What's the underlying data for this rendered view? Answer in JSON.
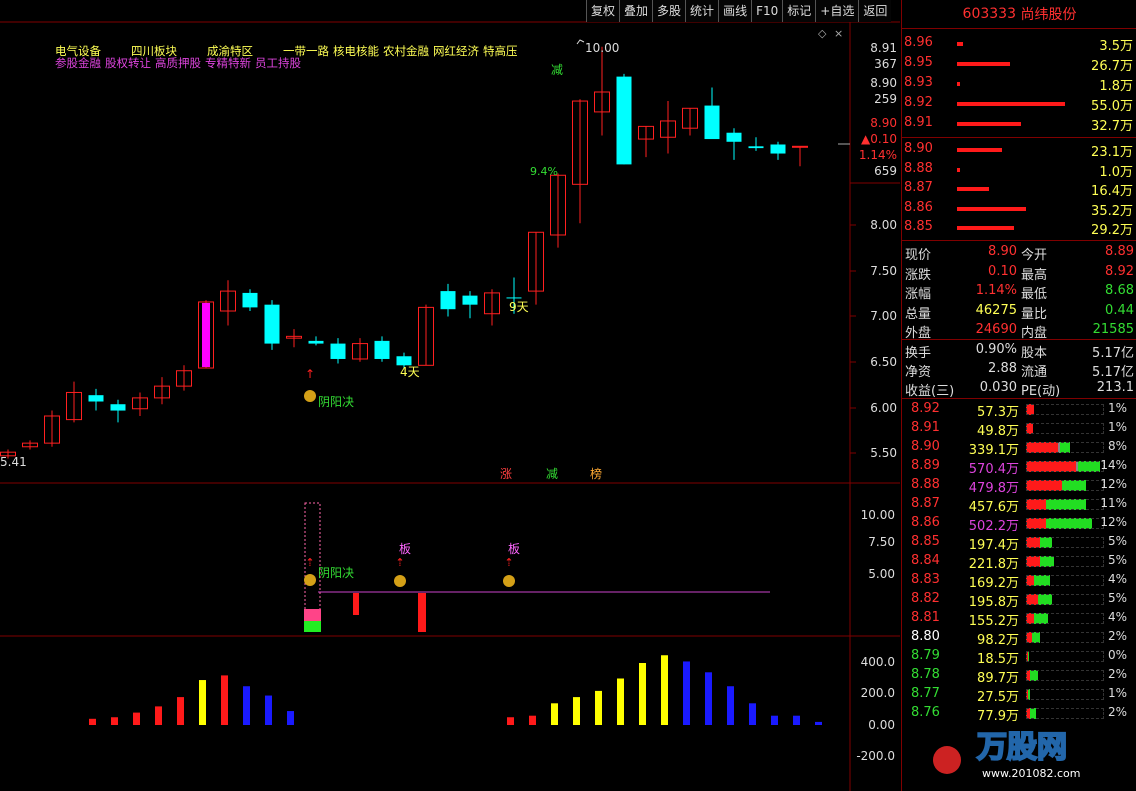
{
  "toolbar": [
    "复权",
    "叠加",
    "多股",
    "统计",
    "画线",
    "F10",
    "标记",
    "+自选",
    "返回"
  ],
  "stock": {
    "code": "603333",
    "name": "尚纬股份"
  },
  "tags": {
    "line1": [
      "电气设备",
      "四川板块",
      "成渝特区",
      "一带一路",
      "核电核能",
      "农村金融",
      "网红经济",
      "特高压"
    ],
    "line2": [
      "参股金融",
      "股权转让",
      "高质押股",
      "专精特新",
      "员工持股"
    ]
  },
  "price_axis": [
    "8.91",
    "367",
    "8.90",
    "259",
    "8.90",
    "▲0.10",
    "1.14%",
    "659",
    "8.00",
    "7.50",
    "7.00",
    "6.50",
    "6.00",
    "5.50"
  ],
  "labels": {
    "high_mark": "10.00",
    "low_mark": "5.41",
    "jian": "减",
    "pct": "9.4%",
    "days9": "9天",
    "days4": "4天",
    "yinyang": "阴阳决",
    "zhang": "涨",
    "jian2": "减",
    "bang": "榜",
    "ban": "板"
  },
  "sub1_axis": [
    "10.00",
    "7.50",
    "5.00"
  ],
  "sub2_axis": [
    "400.0",
    "200.0",
    "0.00",
    "-200.0"
  ],
  "chart_data": {
    "type": "candlestick",
    "candles": [
      {
        "o": 5.48,
        "c": 5.52,
        "h": 5.55,
        "l": 5.45
      },
      {
        "o": 5.58,
        "c": 5.62,
        "h": 5.65,
        "l": 5.55
      },
      {
        "o": 5.62,
        "c": 5.92,
        "h": 5.98,
        "l": 5.58
      },
      {
        "o": 5.88,
        "c": 6.18,
        "h": 6.3,
        "l": 5.85
      },
      {
        "o": 6.15,
        "c": 6.08,
        "h": 6.22,
        "l": 5.98
      },
      {
        "o": 6.05,
        "c": 5.98,
        "h": 6.1,
        "l": 5.85
      },
      {
        "o": 6.0,
        "c": 6.12,
        "h": 6.18,
        "l": 5.92
      },
      {
        "o": 6.12,
        "c": 6.25,
        "h": 6.35,
        "l": 6.05
      },
      {
        "o": 6.25,
        "c": 6.42,
        "h": 6.48,
        "l": 6.2
      },
      {
        "o": 6.45,
        "c": 7.18,
        "h": 7.2,
        "l": 6.45
      },
      {
        "o": 7.08,
        "c": 7.3,
        "h": 7.42,
        "l": 6.92
      },
      {
        "o": 7.28,
        "c": 7.12,
        "h": 7.32,
        "l": 7.08
      },
      {
        "o": 7.15,
        "c": 6.72,
        "h": 7.2,
        "l": 6.65
      },
      {
        "o": 6.78,
        "c": 6.8,
        "h": 6.88,
        "l": 6.68
      },
      {
        "o": 6.75,
        "c": 6.72,
        "h": 6.8,
        "l": 6.7
      },
      {
        "o": 6.72,
        "c": 6.55,
        "h": 6.78,
        "l": 6.5
      },
      {
        "o": 6.55,
        "c": 6.72,
        "h": 6.78,
        "l": 6.52
      },
      {
        "o": 6.75,
        "c": 6.55,
        "h": 6.8,
        "l": 6.52
      },
      {
        "o": 6.58,
        "c": 6.48,
        "h": 6.62,
        "l": 6.45
      },
      {
        "o": 6.48,
        "c": 7.12,
        "h": 7.15,
        "l": 6.48
      },
      {
        "o": 7.3,
        "c": 7.1,
        "h": 7.38,
        "l": 7.02
      },
      {
        "o": 7.25,
        "c": 7.15,
        "h": 7.3,
        "l": 7.0
      },
      {
        "o": 7.05,
        "c": 7.28,
        "h": 7.32,
        "l": 6.92
      },
      {
        "o": 7.23,
        "c": 7.22,
        "h": 7.45,
        "l": 7.05
      },
      {
        "o": 7.3,
        "c": 7.95,
        "h": 7.95,
        "l": 7.15
      },
      {
        "o": 7.92,
        "c": 8.58,
        "h": 8.6,
        "l": 7.78
      },
      {
        "o": 8.48,
        "c": 9.4,
        "h": 9.42,
        "l": 8.05
      },
      {
        "o": 9.28,
        "c": 9.5,
        "h": 10.0,
        "l": 9.02
      },
      {
        "o": 9.67,
        "c": 8.7,
        "h": 9.7,
        "l": 8.7
      },
      {
        "o": 8.98,
        "c": 9.12,
        "h": 9.12,
        "l": 8.78
      },
      {
        "o": 9.0,
        "c": 9.18,
        "h": 9.4,
        "l": 8.82
      },
      {
        "o": 9.1,
        "c": 9.32,
        "h": 9.32,
        "l": 9.02
      },
      {
        "o": 9.35,
        "c": 8.98,
        "h": 9.55,
        "l": 8.98
      },
      {
        "o": 9.05,
        "c": 8.95,
        "h": 9.1,
        "l": 8.75
      },
      {
        "o": 8.9,
        "c": 8.88,
        "h": 9.0,
        "l": 8.85
      },
      {
        "o": 8.92,
        "c": 8.82,
        "h": 8.95,
        "l": 8.75
      },
      {
        "o": 8.9,
        "c": 8.9,
        "h": 8.9,
        "l": 8.68
      }
    ],
    "sub2_bars": [
      {
        "v": 40,
        "c": "#ff1a1a"
      },
      {
        "v": 50,
        "c": "#ff1a1a"
      },
      {
        "v": 80,
        "c": "#ff1a1a"
      },
      {
        "v": 120,
        "c": "#ff1a1a"
      },
      {
        "v": 180,
        "c": "#ff1a1a"
      },
      {
        "v": 290,
        "c": "#ffff00"
      },
      {
        "v": 320,
        "c": "#ff1a1a"
      },
      {
        "v": 250,
        "c": "#1a1aff"
      },
      {
        "v": 190,
        "c": "#1a1aff"
      },
      {
        "v": 90,
        "c": "#1a1aff"
      },
      null,
      null,
      null,
      null,
      null,
      null,
      null,
      null,
      null,
      {
        "v": 50,
        "c": "#ff1a1a"
      },
      {
        "v": 60,
        "c": "#ff1a1a"
      },
      {
        "v": 140,
        "c": "#ffff00"
      },
      {
        "v": 180,
        "c": "#ffff00"
      },
      {
        "v": 220,
        "c": "#ffff00"
      },
      {
        "v": 300,
        "c": "#ffff00"
      },
      {
        "v": 400,
        "c": "#ffff00"
      },
      {
        "v": 450,
        "c": "#ffff00"
      },
      {
        "v": 410,
        "c": "#1a1aff"
      },
      {
        "v": 340,
        "c": "#1a1aff"
      },
      {
        "v": 250,
        "c": "#1a1aff"
      },
      {
        "v": 140,
        "c": "#1a1aff"
      },
      {
        "v": 60,
        "c": "#1a1aff"
      },
      {
        "v": 60,
        "c": "#1a1aff"
      },
      {
        "v": 20,
        "c": "#1a1aff"
      }
    ]
  },
  "orderbook": {
    "asks": [
      {
        "p": "8.96",
        "v": "3.5万",
        "w": 6
      },
      {
        "p": "8.95",
        "v": "26.7万",
        "w": 53
      },
      {
        "p": "8.93",
        "v": "1.8万",
        "w": 3
      },
      {
        "p": "8.92",
        "v": "55.0万",
        "w": 108
      },
      {
        "p": "8.91",
        "v": "32.7万",
        "w": 64
      }
    ],
    "bids": [
      {
        "p": "8.90",
        "v": "23.1万",
        "w": 45
      },
      {
        "p": "8.88",
        "v": "1.0万",
        "w": 3
      },
      {
        "p": "8.87",
        "v": "16.4万",
        "w": 32
      },
      {
        "p": "8.86",
        "v": "35.2万",
        "w": 69
      },
      {
        "p": "8.85",
        "v": "29.2万",
        "w": 57
      }
    ]
  },
  "quote": [
    {
      "l1": "现价",
      "v1": "8.90",
      "c1": "#ff3030",
      "l2": "今开",
      "v2": "8.89",
      "c2": "#ff3030"
    },
    {
      "l1": "涨跌",
      "v1": "0.10",
      "c1": "#ff3030",
      "l2": "最高",
      "v2": "8.92",
      "c2": "#ff3030"
    },
    {
      "l1": "涨幅",
      "v1": "1.14%",
      "c1": "#ff3030",
      "l2": "最低",
      "v2": "8.68",
      "c2": "#33dd33"
    },
    {
      "l1": "总量",
      "v1": "46275",
      "c1": "#ffff55",
      "l2": "量比",
      "v2": "0.44",
      "c2": "#33dd33"
    },
    {
      "l1": "外盘",
      "v1": "24690",
      "c1": "#ff3030",
      "l2": "内盘",
      "v2": "21585",
      "c2": "#33dd33"
    }
  ],
  "quote2": [
    {
      "l1": "换手",
      "v1": "0.90%",
      "l2": "股本",
      "v2": "5.17亿"
    },
    {
      "l1": "净资",
      "v1": "2.88",
      "l2": "流通",
      "v2": "5.17亿"
    },
    {
      "l1": "收益(三)",
      "v1": "0.030",
      "l2": "PE(动)",
      "v2": "213.1"
    }
  ],
  "vol_dist": [
    {
      "p": "8.92",
      "v": "57.3万",
      "pc": "#ff3030",
      "vc": "#ffff55",
      "r": 8,
      "g": 0,
      "pct": "1%"
    },
    {
      "p": "8.91",
      "v": "49.8万",
      "pc": "#ff3030",
      "vc": "#ffff55",
      "r": 7,
      "g": 0,
      "pct": "1%"
    },
    {
      "p": "8.90",
      "v": "339.1万",
      "pc": "#ff3030",
      "vc": "#ffff55",
      "r": 32,
      "g": 10,
      "gy": 2,
      "pct": "8%"
    },
    {
      "p": "8.89",
      "v": "570.4万",
      "pc": "#ff3030",
      "vc": "#dd44dd",
      "r": 50,
      "g": 22,
      "gy": 2,
      "pct": "14%"
    },
    {
      "p": "8.88",
      "v": "479.8万",
      "pc": "#ff3030",
      "vc": "#dd44dd",
      "r": 36,
      "g": 24,
      "pct": "12%"
    },
    {
      "p": "8.87",
      "v": "457.6万",
      "pc": "#ff3030",
      "vc": "#ffff55",
      "r": 20,
      "g": 40,
      "pct": "11%"
    },
    {
      "p": "8.86",
      "v": "502.2万",
      "pc": "#ff3030",
      "vc": "#dd44dd",
      "r": 20,
      "g": 46,
      "pct": "12%"
    },
    {
      "p": "8.85",
      "v": "197.4万",
      "pc": "#ff3030",
      "vc": "#ffff55",
      "r": 14,
      "g": 12,
      "pct": "5%"
    },
    {
      "p": "8.84",
      "v": "221.8万",
      "pc": "#ff3030",
      "vc": "#ffff55",
      "r": 14,
      "g": 14,
      "pct": "5%"
    },
    {
      "p": "8.83",
      "v": "169.2万",
      "pc": "#ff3030",
      "vc": "#ffff55",
      "r": 8,
      "g": 16,
      "pct": "4%"
    },
    {
      "p": "8.82",
      "v": "195.8万",
      "pc": "#ff3030",
      "vc": "#ffff55",
      "r": 12,
      "g": 14,
      "pct": "5%"
    },
    {
      "p": "8.81",
      "v": "155.2万",
      "pc": "#ff3030",
      "vc": "#ffff55",
      "r": 8,
      "g": 14,
      "pct": "4%"
    },
    {
      "p": "8.80",
      "v": "98.2万",
      "pc": "#ffffff",
      "vc": "#ffff55",
      "r": 6,
      "g": 8,
      "pct": "2%"
    },
    {
      "p": "8.79",
      "v": "18.5万",
      "pc": "#33dd33",
      "vc": "#ffff55",
      "r": 2,
      "g": 1,
      "pct": "0%"
    },
    {
      "p": "8.78",
      "v": "89.7万",
      "pc": "#33dd33",
      "vc": "#ffff55",
      "r": 4,
      "g": 8,
      "pct": "2%"
    },
    {
      "p": "8.77",
      "v": "27.5万",
      "pc": "#33dd33",
      "vc": "#ffff55",
      "r": 2,
      "g": 2,
      "pct": "1%"
    },
    {
      "p": "8.76",
      "v": "77.9万",
      "pc": "#33dd33",
      "vc": "#ffff55",
      "r": 4,
      "g": 6,
      "pct": "2%"
    }
  ],
  "watermark": "万股网 www.201082.com"
}
